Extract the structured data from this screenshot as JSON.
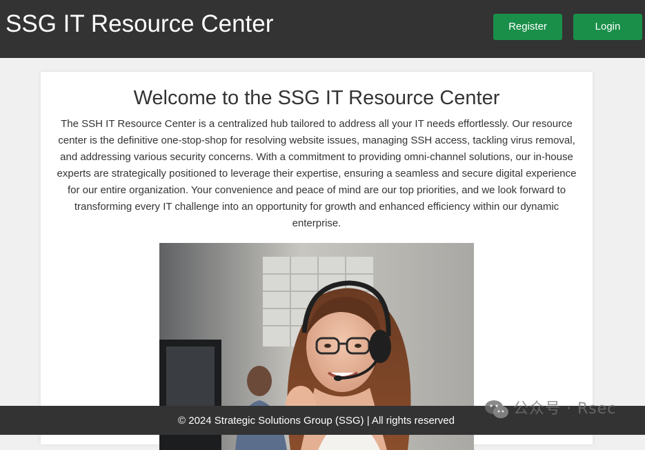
{
  "header": {
    "site_title": "SSG IT Resource Center",
    "register_label": "Register",
    "login_label": "Login"
  },
  "main": {
    "welcome_title": "Welcome to the SSG IT Resource Center",
    "intro_text": "The SSH IT Resource Center is a centralized hub tailored to address all your IT needs effortlessly. Our resource center is the definitive one-stop-shop for resolving website issues, managing SSH access, tackling virus removal, and addressing various security concerns. With a commitment to providing omni-channel solutions, our in-house experts are strategically positioned to leverage their expertise, ensuring a seamless and secure digital experience for our entire organization. Your convenience and peace of mind are our top priorities, and we look forward to transforming every IT challenge into an opportunity for growth and enhanced efficiency within our dynamic enterprise."
  },
  "footer": {
    "copyright": "© 2024 Strategic Solutions Group (SSG) | All rights reserved"
  },
  "watermark": {
    "text": "公众号 · Rsec",
    "icon": "wechat-icon"
  },
  "colors": {
    "header_bg": "#333333",
    "button_bg": "#1a8f4a",
    "page_bg": "#f0f0f0",
    "card_bg": "#ffffff"
  }
}
